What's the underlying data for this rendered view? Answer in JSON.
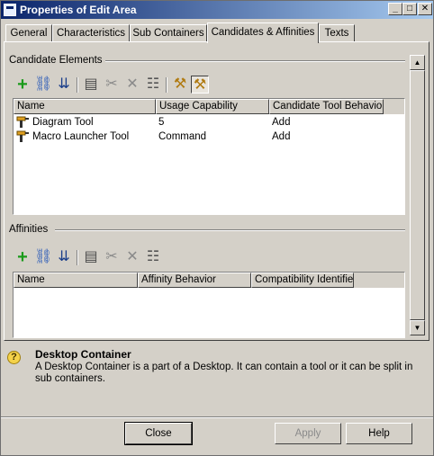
{
  "window": {
    "title": "Properties of Edit Area",
    "controls": {
      "minimize": "_",
      "maximize": "□",
      "close": "✕"
    }
  },
  "tabs": [
    {
      "label": "General",
      "active": false
    },
    {
      "label": "Characteristics",
      "active": false
    },
    {
      "label": "Sub Containers",
      "active": false
    },
    {
      "label": "Candidates & Affinities",
      "active": true
    },
    {
      "label": "Texts",
      "active": false
    }
  ],
  "candidates": {
    "section_label": "Candidate Elements",
    "toolbar": [
      "add-icon",
      "link-icon",
      "import-icon",
      "properties-icon",
      "unlink-icon",
      "delete-icon",
      "database-icon",
      "tool-icon",
      "candidate-tool-icon"
    ],
    "columns": [
      "Name",
      "Usage Capability",
      "Candidate Tool Behavior"
    ],
    "rows": [
      {
        "icon": "candidate-tool-icon",
        "name": "Diagram Tool",
        "usage": "5",
        "behavior": "Add"
      },
      {
        "icon": "candidate-tool-icon",
        "name": "Macro Launcher Tool",
        "usage": "Command",
        "behavior": "Add"
      }
    ]
  },
  "affinities": {
    "section_label": "Affinities",
    "toolbar": [
      "add-icon",
      "link-icon",
      "import-icon",
      "properties-icon",
      "unlink-icon",
      "delete-icon",
      "database-icon"
    ],
    "columns": [
      "Name",
      "Affinity Behavior",
      "Compatibility Identifier"
    ],
    "rows": []
  },
  "description": {
    "title": "Desktop Container",
    "body": "A Desktop Container is a part of a Desktop. It can contain a tool or it can be split in sub containers."
  },
  "buttons": {
    "close": "Close",
    "apply": "Apply",
    "help": "Help"
  },
  "colors": {
    "face": "#d4d0c8",
    "title_start": "#0a246a",
    "title_end": "#a6caf0",
    "add_green": "#1a9a1a"
  }
}
